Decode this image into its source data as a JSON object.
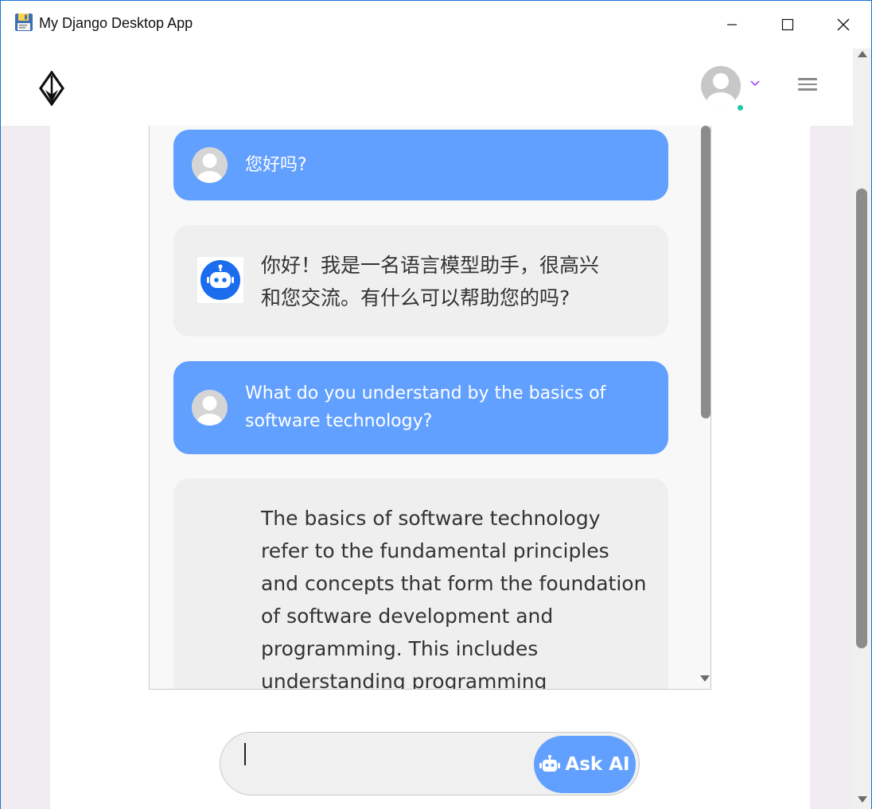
{
  "window": {
    "title": "My Django Desktop App"
  },
  "navbar": {
    "logo_icon": "diamond-arrow-logo",
    "avatar_icon": "user-avatar-icon",
    "status": "online",
    "menu_icon": "hamburger-icon"
  },
  "colors": {
    "user_bubble": "#62a0ff",
    "ai_bubble": "#efefef",
    "accent": "#62a0ff",
    "online": "#21c7a8",
    "caret_accent": "#a855f7"
  },
  "chat": {
    "messages": [
      {
        "role": "user",
        "text": "您好吗?"
      },
      {
        "role": "ai",
        "lines": [
          "你好！我是一名语言模型助手，很高兴",
          "和您交流。有什么可以帮助您的吗?"
        ]
      },
      {
        "role": "user",
        "lines": [
          "What do you understand by the basics of",
          "software technology?"
        ]
      },
      {
        "role": "ai",
        "lines": [
          "The basics of software technology",
          "refer to the fundamental principles",
          "and concepts that form the foundation",
          "of software development and",
          "programming. This includes",
          "understanding programming"
        ]
      }
    ]
  },
  "input": {
    "value": "",
    "placeholder": "",
    "button_label": "Ask AI",
    "button_icon": "robot-icon"
  }
}
